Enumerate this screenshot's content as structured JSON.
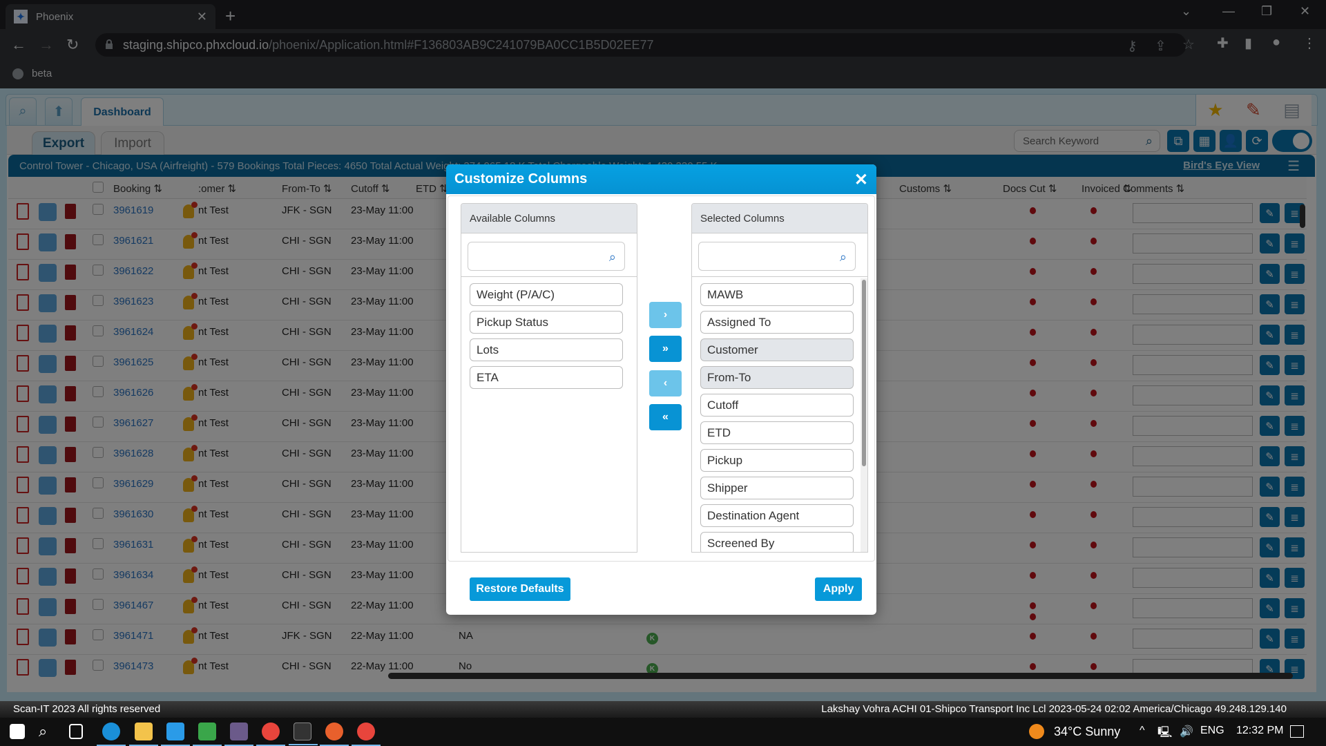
{
  "browser": {
    "tab_title": "Phoenix",
    "url_host": "staging.shipco.phxcloud.io",
    "url_path": "/phoenix/Application.html#F136803AB9C241079BA0CC1B5D02EE77",
    "bookmark_label": "beta"
  },
  "app": {
    "dashboard_tab": "Dashboard",
    "subtabs": [
      "Export",
      "Import"
    ],
    "search_placeholder": "Search Keyword",
    "summary": "Control Tower - Chicago, USA (Airfreight) - 579 Bookings Total Pieces: 4650 Total Actual Weight: 374,965.18 K  Total Chargeable Weight: 1,430,330.55 K",
    "birds_eye_view": "Bird's Eye View"
  },
  "grid": {
    "headers": {
      "booking": "Booking ⇅",
      "customer": ":omer ⇅",
      "from_to": "From-To ⇅",
      "cutoff": "Cutoff ⇅",
      "etd": "ETD ⇅",
      "customs": "Customs ⇅",
      "docs_cut": "Docs Cut ⇅",
      "invoiced": "Invoiced ⇅",
      "comments": "Comments ⇅"
    },
    "rows": [
      {
        "booking": "3961619",
        "customer": "nt Test",
        "from_to": "JFK - SGN",
        "cutoff": "23-May 11:00",
        "etd": "",
        "k": false,
        "docs_dots": 1
      },
      {
        "booking": "3961621",
        "customer": "nt Test",
        "from_to": "CHI - SGN",
        "cutoff": "23-May 11:00",
        "etd": "",
        "k": false,
        "docs_dots": 1
      },
      {
        "booking": "3961622",
        "customer": "nt Test",
        "from_to": "CHI - SGN",
        "cutoff": "23-May 11:00",
        "etd": "",
        "k": false,
        "docs_dots": 1
      },
      {
        "booking": "3961623",
        "customer": "nt Test",
        "from_to": "CHI - SGN",
        "cutoff": "23-May 11:00",
        "etd": "",
        "k": false,
        "docs_dots": 1
      },
      {
        "booking": "3961624",
        "customer": "nt Test",
        "from_to": "CHI - SGN",
        "cutoff": "23-May 11:00",
        "etd": "",
        "k": false,
        "docs_dots": 1
      },
      {
        "booking": "3961625",
        "customer": "nt Test",
        "from_to": "CHI - SGN",
        "cutoff": "23-May 11:00",
        "etd": "",
        "k": false,
        "docs_dots": 1
      },
      {
        "booking": "3961626",
        "customer": "nt Test",
        "from_to": "CHI - SGN",
        "cutoff": "23-May 11:00",
        "etd": "",
        "k": false,
        "docs_dots": 1
      },
      {
        "booking": "3961627",
        "customer": "nt Test",
        "from_to": "CHI - SGN",
        "cutoff": "23-May 11:00",
        "etd": "",
        "k": false,
        "docs_dots": 1
      },
      {
        "booking": "3961628",
        "customer": "nt Test",
        "from_to": "CHI - SGN",
        "cutoff": "23-May 11:00",
        "etd": "",
        "k": false,
        "docs_dots": 1
      },
      {
        "booking": "3961629",
        "customer": "nt Test",
        "from_to": "CHI - SGN",
        "cutoff": "23-May 11:00",
        "etd": "",
        "k": false,
        "docs_dots": 1
      },
      {
        "booking": "3961630",
        "customer": "nt Test",
        "from_to": "CHI - SGN",
        "cutoff": "23-May 11:00",
        "etd": "",
        "k": false,
        "docs_dots": 1
      },
      {
        "booking": "3961631",
        "customer": "nt Test",
        "from_to": "CHI - SGN",
        "cutoff": "23-May 11:00",
        "etd": "",
        "k": false,
        "docs_dots": 1
      },
      {
        "booking": "3961634",
        "customer": "nt Test",
        "from_to": "CHI - SGN",
        "cutoff": "23-May 11:00",
        "etd": "",
        "k": false,
        "docs_dots": 1
      },
      {
        "booking": "3961467",
        "customer": "nt Test",
        "from_to": "CHI - SGN",
        "cutoff": "22-May 11:00",
        "etd": "",
        "k": false,
        "docs_dots": 2
      },
      {
        "booking": "3961471",
        "customer": "nt Test",
        "from_to": "JFK - SGN",
        "cutoff": "22-May 11:00",
        "etd": "NA",
        "k": true,
        "docs_dots": 1
      },
      {
        "booking": "3961473",
        "customer": "nt Test",
        "from_to": "CHI - SGN",
        "cutoff": "22-May 11:00",
        "etd": "No",
        "k": true,
        "docs_dots": 1
      }
    ]
  },
  "modal": {
    "title": "Customize Columns",
    "available_title": "Available Columns",
    "selected_title": "Selected Columns",
    "available": [
      "Weight (P/A/C)",
      "Pickup Status",
      "Lots",
      "ETA"
    ],
    "selected": [
      "MAWB",
      "Assigned To",
      "Customer",
      "From-To",
      "Cutoff",
      "ETD",
      "Pickup",
      "Shipper",
      "Destination Agent",
      "Screened By"
    ],
    "highlighted_selected": [
      "Customer",
      "From-To"
    ],
    "move_buttons": [
      "›",
      "»",
      "‹",
      "«"
    ],
    "restore_label": "Restore Defaults",
    "apply_label": "Apply"
  },
  "footer": {
    "left": "Scan-IT 2023 All rights reserved",
    "right": "Lakshay Vohra ACHI 01-Shipco Transport Inc Lcl 2023-05-24 02:02 America/Chicago 49.248.129.140"
  },
  "taskbar": {
    "weather": "34°C  Sunny",
    "lang": "ENG",
    "time": "12:32 PM"
  }
}
